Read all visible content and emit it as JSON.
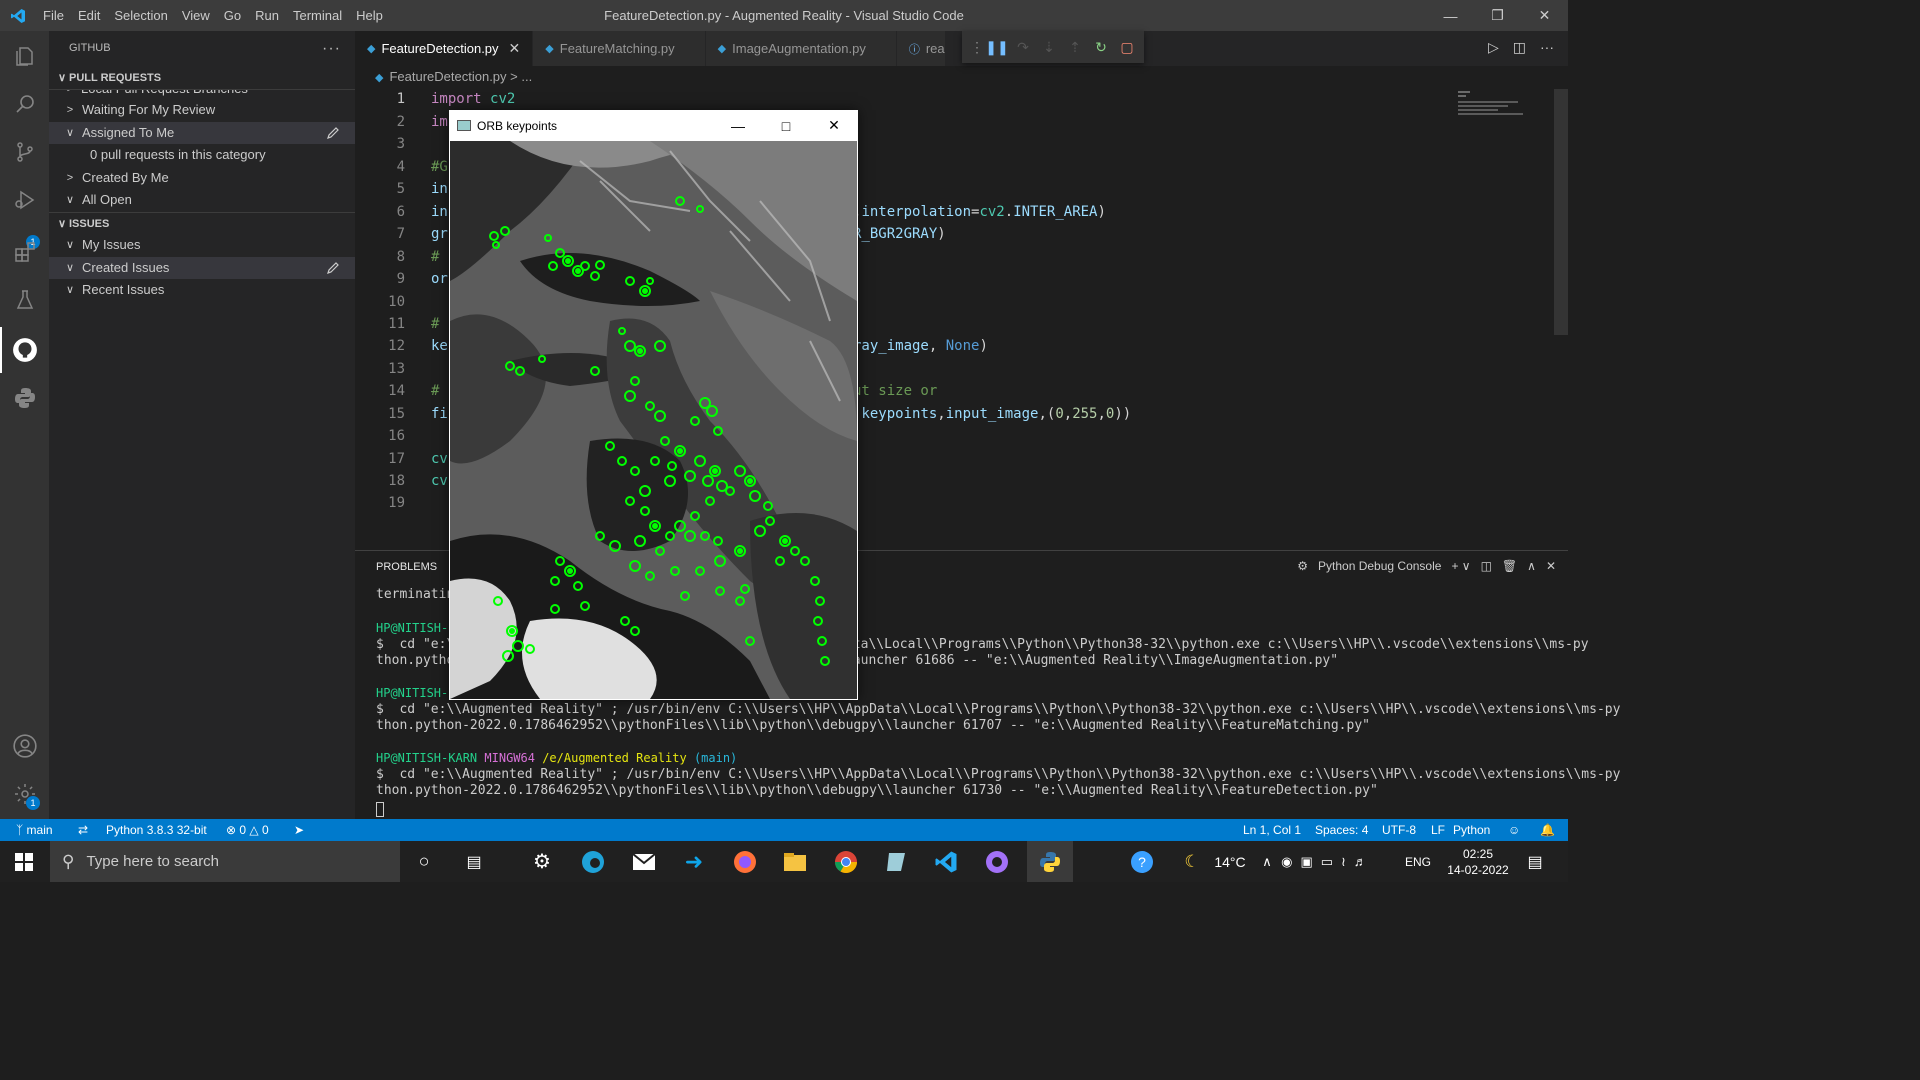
{
  "app": {
    "title": "FeatureDetection.py - Augmented Reality - Visual Studio Code",
    "menu": [
      "File",
      "Edit",
      "Selection",
      "View",
      "Go",
      "Run",
      "Terminal",
      "Help"
    ]
  },
  "activity": {
    "debug_badge": "1",
    "settings_badge": "1"
  },
  "sidebar": {
    "title": "GITHUB",
    "pull_requests": {
      "header": "PULL REQUESTS",
      "partial": "Local Pull Request Branches",
      "items": [
        "Waiting For My Review",
        "Assigned To Me",
        "Created By Me",
        "All Open"
      ],
      "empty": "0 pull requests in this category"
    },
    "issues": {
      "header": "ISSUES",
      "items": [
        "My Issues",
        "Created Issues",
        "Recent Issues"
      ]
    }
  },
  "tabs": [
    "FeatureDetection.py",
    "FeatureMatching.py",
    "ImageAugmentation.py",
    "rea"
  ],
  "breadcrumb": {
    "file": "FeatureDetection.py",
    "more": "..."
  },
  "code": {
    "line_numbers": [
      "1",
      "2",
      "3",
      "4",
      "5",
      "6",
      "7",
      "8",
      "9",
      "10",
      "11",
      "12",
      "13",
      "14",
      "15",
      "16",
      "17",
      "18",
      "19"
    ]
  },
  "panel": {
    "tab": "PROBLEMS",
    "console": "Python Debug Console",
    "lines": {
      "t0": "terminatin",
      "p1": "HP@NITISH-",
      "c1a": "$  cd \"e:\\",
      "c1b": "ata\\\\Local\\\\Programs\\\\Python\\\\Python38-32\\\\python.exe c:\\\\Users\\\\HP\\\\.vscode\\\\extensions\\\\ms-py",
      "c1c": "thon.pytho",
      "c1d": "launcher 61686 -- \"e:\\\\Augmented Reality\\\\ImageAugmentation.py\"",
      "p2": "HP@NITISH-",
      "c2a": "$  cd \"e:\\\\Augmented Reality\" ; /usr/bin/env C:\\\\Users\\\\HP\\\\AppData\\\\Local\\\\Programs\\\\Python\\\\Python38-32\\\\python.exe c:\\\\Users\\\\HP\\\\.vscode\\\\extensions\\\\ms-py",
      "c2b": "thon.python-2022.0.1786462952\\\\pythonFiles\\\\lib\\\\python\\\\debugpy\\\\launcher 61707 -- \"e:\\\\Augmented Reality\\\\FeatureMatching.py\"",
      "p3_user": "HP@NITISH-KARN",
      "p3_sys": "MINGW64",
      "p3_path": "/e/Augmented Reality",
      "p3_branch": "(main)",
      "c3a": "$  cd \"e:\\\\Augmented Reality\" ; /usr/bin/env C:\\\\Users\\\\HP\\\\AppData\\\\Local\\\\Programs\\\\Python\\\\Python38-32\\\\python.exe c:\\\\Users\\\\HP\\\\.vscode\\\\extensions\\\\ms-py",
      "c3b": "thon.python-2022.0.1786462952\\\\pythonFiles\\\\lib\\\\python\\\\debugpy\\\\launcher 61730 -- \"e:\\\\Augmented Reality\\\\FeatureDetection.py\""
    }
  },
  "status": {
    "branch": "main",
    "python": "Python 3.8.3 32-bit",
    "errors": "0",
    "warnings": "0",
    "position": "Ln 1, Col 1",
    "spaces": "Spaces: 4",
    "encoding": "UTF-8",
    "eol": "LF",
    "language": "Python"
  },
  "cv_window": {
    "title": "ORB keypoints"
  },
  "taskbar": {
    "search_placeholder": "Type here to search",
    "temperature": "14°C",
    "language": "ENG",
    "time": "02:25",
    "date": "14-02-2022"
  },
  "colors": {
    "accent": "#007acc",
    "keypoint": "#00ff00"
  }
}
